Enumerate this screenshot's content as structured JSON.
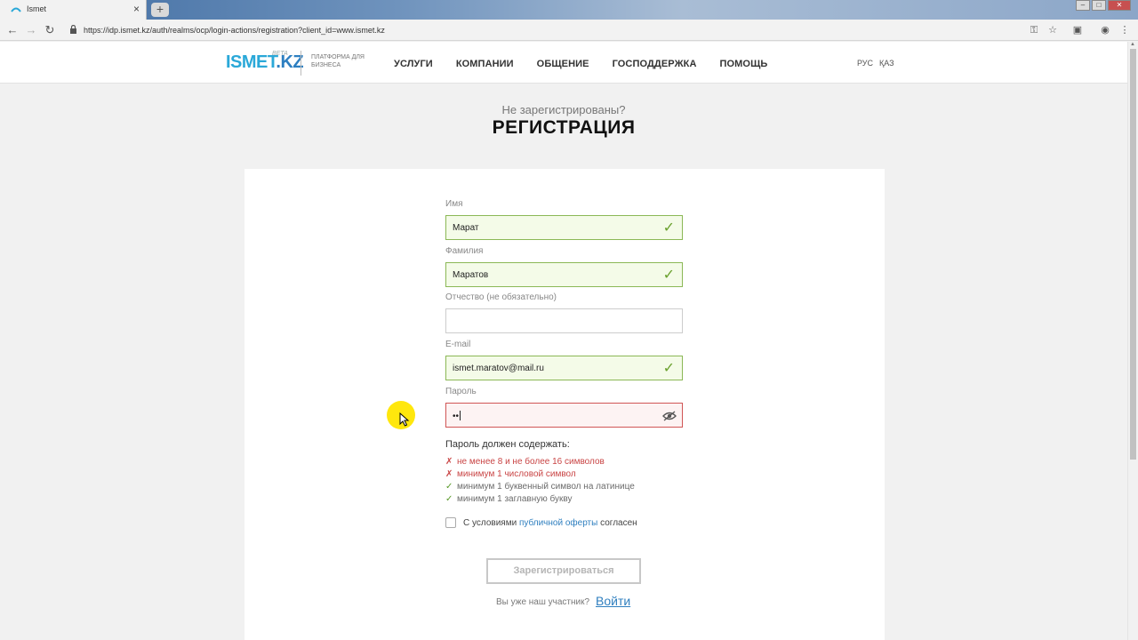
{
  "browser": {
    "tab_title": "Ismet",
    "tab_close": "×",
    "new_tab": "+",
    "url": "https://idp.ismet.kz/auth/realms/ocp/login-actions/registration?client_id=www.ismet.kz"
  },
  "header": {
    "logo_main": "ISMET",
    "logo_kz": ".KZ",
    "logo_beta": "BETA",
    "logo_sub": "ПЛАТФОРМА ДЛЯ БИЗНЕСА",
    "nav": [
      "УСЛУГИ",
      "КОМПАНИИ",
      "ОБЩЕНИЕ",
      "ГОСПОДДЕРЖКА",
      "ПОМОЩЬ"
    ],
    "lang_ru": "РУС",
    "lang_kz": "ҚАЗ"
  },
  "page": {
    "subtitle": "Не зарегистрированы?",
    "title": "РЕГИСТРАЦИЯ"
  },
  "form": {
    "first_name": {
      "label": "Имя",
      "value": "Марат",
      "status": "valid"
    },
    "last_name": {
      "label": "Фамилия",
      "value": "Маратов",
      "status": "valid"
    },
    "middle_name": {
      "label": "Отчество (не обязательно)",
      "value": ""
    },
    "email": {
      "label": "E-mail",
      "value": "ismet.maratov@mail.ru",
      "status": "valid"
    },
    "password": {
      "label": "Пароль",
      "value": "••",
      "status": "invalid"
    },
    "check_mark": "✓",
    "requirements_title": "Пароль должен содержать:",
    "requirements": [
      {
        "text": "не менее 8 и не более 16 символов",
        "met": false,
        "mark": "✗"
      },
      {
        "text": "минимум 1 числовой символ",
        "met": false,
        "mark": "✗"
      },
      {
        "text": "минимум 1 буквенный символ на латинице",
        "met": true,
        "mark": "✓"
      },
      {
        "text": "минимум 1 заглавную букву",
        "met": true,
        "mark": "✓"
      }
    ],
    "agree_prefix": "С условиями",
    "agree_link": "публичной оферты",
    "agree_suffix": "согласен",
    "agree_checked": false,
    "submit_label": "Зарегистрироваться",
    "already_text": "Вы уже наш участник?",
    "login_link": "Войти"
  },
  "colors": {
    "valid_border": "#8bb856",
    "invalid_border": "#d05555",
    "link": "#2f7fbf",
    "brand": "#2aa8d8"
  }
}
